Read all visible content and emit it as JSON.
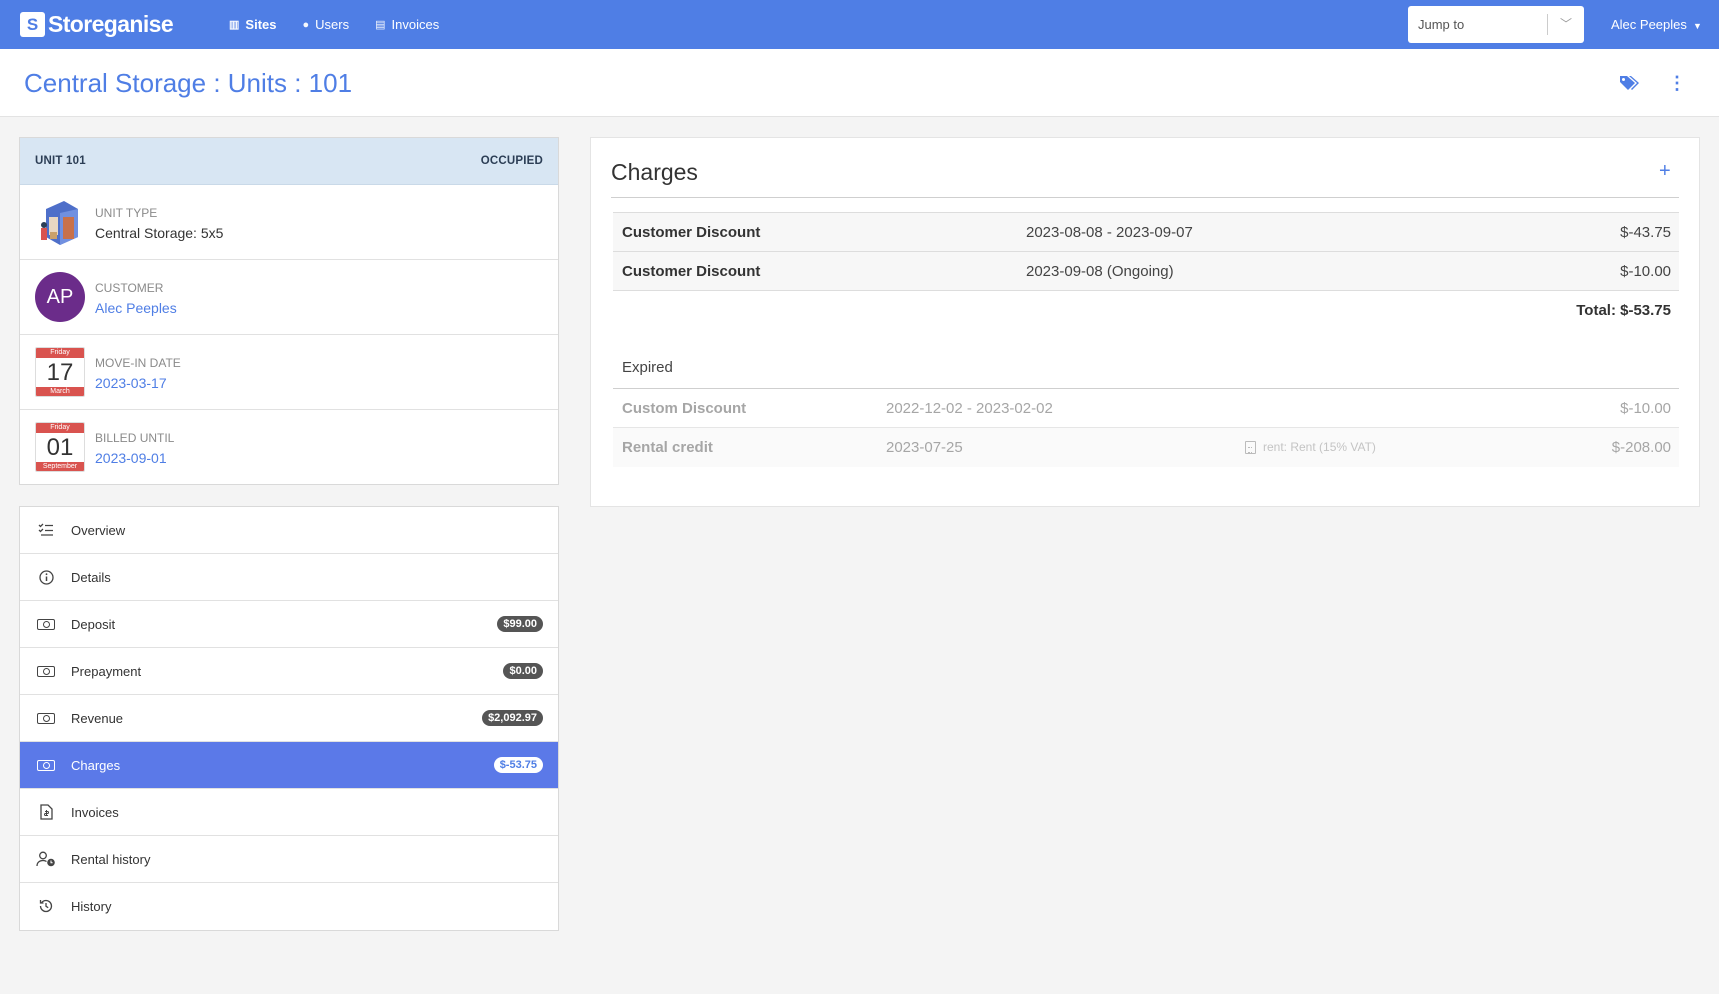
{
  "navbar": {
    "brand": "Storeganise",
    "links": [
      {
        "label": "Sites",
        "icon": "building-icon",
        "active": true
      },
      {
        "label": "Users",
        "icon": "user-icon",
        "active": false
      },
      {
        "label": "Invoices",
        "icon": "document-icon",
        "active": false
      }
    ],
    "jump_placeholder": "Jump to",
    "user_name": "Alec Peeples"
  },
  "page": {
    "title": "Central Storage : Units : 101"
  },
  "unit_card": {
    "unit_label": "UNIT 101",
    "status": "OCCUPIED",
    "rows": {
      "unit_type": {
        "label": "UNIT TYPE",
        "value": "Central Storage: 5x5"
      },
      "customer": {
        "label": "CUSTOMER",
        "value": "Alec Peeples",
        "initials": "AP"
      },
      "move_in": {
        "label": "MOVE-IN DATE",
        "value": "2023-03-17",
        "cal_day": "Friday",
        "cal_num": "17",
        "cal_month": "March"
      },
      "billed_until": {
        "label": "BILLED UNTIL",
        "value": "2023-09-01",
        "cal_day": "Friday",
        "cal_num": "01",
        "cal_month": "September"
      }
    }
  },
  "menu": {
    "items": [
      {
        "label": "Overview",
        "icon": "checklist-icon"
      },
      {
        "label": "Details",
        "icon": "info-icon"
      },
      {
        "label": "Deposit",
        "icon": "cash-icon",
        "badge": "$99.00"
      },
      {
        "label": "Prepayment",
        "icon": "cash-icon",
        "badge": "$0.00"
      },
      {
        "label": "Revenue",
        "icon": "cash-icon",
        "badge": "$2,092.97"
      },
      {
        "label": "Charges",
        "icon": "cash-icon",
        "badge": "$-53.75",
        "active": true
      },
      {
        "label": "Invoices",
        "icon": "invoice-icon"
      },
      {
        "label": "Rental history",
        "icon": "user-clock-icon"
      },
      {
        "label": "History",
        "icon": "history-icon"
      }
    ]
  },
  "charges": {
    "title": "Charges",
    "rows": [
      {
        "name": "Customer Discount",
        "period": "2023-08-08 - 2023-09-07",
        "amount": "$-43.75"
      },
      {
        "name": "Customer Discount",
        "period": "2023-09-08 (Ongoing)",
        "amount": "$-10.00"
      }
    ],
    "total": "Total: $-53.75",
    "expired_label": "Expired",
    "expired_rows": [
      {
        "name": "Custom Discount",
        "period": "2022-12-02 - 2023-02-02",
        "note": "",
        "amount": "$-10.00"
      },
      {
        "name": "Rental credit",
        "period": "2023-07-25",
        "note": "rent: Rent (15% VAT)",
        "amount": "$-208.00"
      }
    ]
  },
  "colors": {
    "brand": "#4f7ee5",
    "menu_active": "#5b79e8",
    "avatar": "#6b2c8a",
    "calendar": "#d9534f",
    "unit_header": "#d8e6f3"
  }
}
